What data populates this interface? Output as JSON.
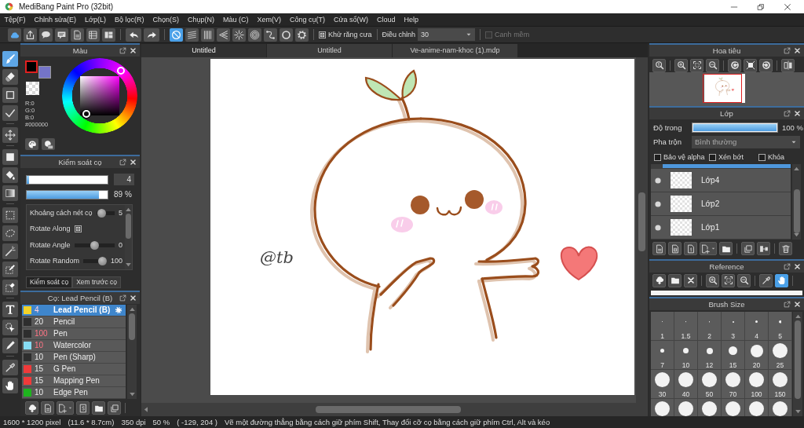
{
  "window": {
    "title": "MediBang Paint Pro (32bit)"
  },
  "menu": [
    "Tệp(F)",
    "Chỉnh sửa(E)",
    "Lớp(L)",
    "Bộ lọc(R)",
    "Chọn(S)",
    "Chụp(N)",
    "Màu (C)",
    "Xem(V)",
    "Công cụ(T)",
    "Cửa sổ(W)",
    "Cloud",
    "Help"
  ],
  "toolbar": {
    "snap_modes": [
      {
        "selected": true
      },
      {
        "selected": false
      },
      {
        "selected": false
      },
      {
        "selected": false
      },
      {
        "selected": false
      },
      {
        "selected": false
      },
      {
        "selected": false
      },
      {
        "selected": false
      },
      {
        "selected": false
      }
    ],
    "antialias": {
      "label": "Khử răng cưa",
      "checked": true,
      "disabled": false
    },
    "correction": {
      "label": "Điều chỉnh",
      "value": "30"
    },
    "soft_edge": {
      "label": "Canh mềm",
      "checked": false,
      "disabled": true
    }
  },
  "tool_groups": [
    {
      "tools": [
        {
          "selected": true
        },
        {
          "selected": false
        },
        {
          "selected": false
        },
        {
          "selected": false
        }
      ]
    },
    {
      "tools": [
        {
          "selected": false
        }
      ]
    },
    {
      "tools": [
        {
          "selected": false
        },
        {
          "selected": false
        },
        {
          "selected": false
        }
      ]
    },
    {
      "tools": [
        {
          "selected": false
        },
        {
          "selected": false
        },
        {
          "selected": false
        },
        {
          "selected": false
        },
        {
          "selected": false
        }
      ]
    },
    {
      "tools": [
        {
          "selected": false
        },
        {
          "selected": false
        },
        {
          "selected": false
        }
      ]
    },
    {
      "tools": [
        {
          "selected": false
        },
        {
          "selected": false
        }
      ]
    }
  ],
  "color_panel": {
    "title": "Màu",
    "swatches": [
      {
        "color": "#000000",
        "selected": true
      },
      {
        "color": "#7474c8",
        "selected": false
      }
    ],
    "readout": [
      "R:0",
      "G:0",
      "B:0",
      "#000000"
    ]
  },
  "brush_control": {
    "title": "Kiểm soát cọ",
    "size": {
      "level": 0.03,
      "value": "4"
    },
    "opacity": {
      "level": 0.89,
      "reading": "89 %"
    },
    "settings": [
      {
        "kind": "slider",
        "label": "Khoảng cách nét cọ",
        "level": 0.1,
        "reading": "5"
      },
      {
        "kind": "checkbox",
        "label": "Rotate Along",
        "checked": true
      },
      {
        "kind": "slider",
        "label": "Rotate Angle",
        "level": 0.5,
        "reading": "0"
      },
      {
        "kind": "slider",
        "label": "Rotate Random",
        "level": 1,
        "reading": "100"
      }
    ],
    "tabs": [
      {
        "label": "Kiểm soát cọ",
        "selected": true
      },
      {
        "label": "Xem trước cọ",
        "selected": false
      }
    ]
  },
  "brush_list": {
    "title": "Cọ: Lead Pencil (B)",
    "brushes": [
      {
        "color": "#f2d22a",
        "size": "4",
        "name": "Lead Pencil (B)",
        "size_flagged": true,
        "selected": true
      },
      {
        "color": "#2e2e2e",
        "size": "20",
        "name": "Pencil",
        "size_flagged": false,
        "selected": false
      },
      {
        "color": "#2e2e2e",
        "size": "100",
        "name": "Pen",
        "size_flagged": true,
        "selected": false
      },
      {
        "color": "#86dcf4",
        "size": "10",
        "name": "Watercolor",
        "size_flagged": true,
        "selected": false
      },
      {
        "color": "#2e2e2e",
        "size": "10",
        "name": "Pen (Sharp)",
        "size_flagged": false,
        "selected": false
      },
      {
        "color": "#f03a3a",
        "size": "15",
        "name": "G Pen",
        "size_flagged": false,
        "selected": false
      },
      {
        "color": "#f03a3a",
        "size": "15",
        "name": "Mapping Pen",
        "size_flagged": false,
        "selected": false
      },
      {
        "color": "#1eb41e",
        "size": "10",
        "name": "Edge Pen",
        "size_flagged": false,
        "selected": false
      }
    ]
  },
  "document_tabs": [
    {
      "label": "Untitled",
      "selected": true
    },
    {
      "label": "Untitled",
      "selected": false
    },
    {
      "label": "Ve-anime-nam-khoc (1).mdp",
      "selected": false
    }
  ],
  "canvas": {
    "signature": "@tb"
  },
  "navigator": {
    "title": "Hoa tiêu"
  },
  "layers": {
    "title": "Lớp",
    "opacity": {
      "label": "Độ trong",
      "level": 1,
      "reading": "100 %"
    },
    "blend": {
      "label": "Pha trộn",
      "value": "Bình thường"
    },
    "options": [
      {
        "label": "Bảo vệ alpha",
        "checked": false
      },
      {
        "label": "Xén bớt",
        "checked": false
      },
      {
        "label": "Khóa",
        "checked": false
      }
    ],
    "items": [
      {
        "kind": "clipped",
        "selected": true
      },
      {
        "kind": "layer",
        "name": "Lớp4",
        "visible": true,
        "selected": false
      },
      {
        "kind": "layer",
        "name": "Lớp2",
        "visible": true,
        "selected": false
      },
      {
        "kind": "layer",
        "name": "Lớp1",
        "visible": true,
        "selected": false
      }
    ]
  },
  "reference": {
    "title": "Reference",
    "tools": [
      {
        "selected": false
      },
      {
        "selected": false
      },
      {
        "selected": false
      },
      {
        "selected": false
      },
      {
        "selected": false
      },
      {
        "selected": false
      },
      {
        "selected": false
      },
      {
        "selected": true
      }
    ]
  },
  "brush_size": {
    "title": "Brush Size",
    "sizes": [
      "1",
      "1.5",
      "2",
      "3",
      "4",
      "5",
      "7",
      "10",
      "12",
      "15",
      "20",
      "25",
      "30",
      "40",
      "50",
      "70",
      "100",
      "150"
    ]
  },
  "status_bar": [
    "1600 * 1200 pixel",
    "(11.6 * 8.7cm)",
    "350 dpi",
    "50 %",
    "( -129, 204 )",
    "Vẽ một đường thẳng bằng cách giữ phím Shift, Thay đổi cỡ cọ bằng cách giữ phím Ctrl, Alt và kéo"
  ]
}
